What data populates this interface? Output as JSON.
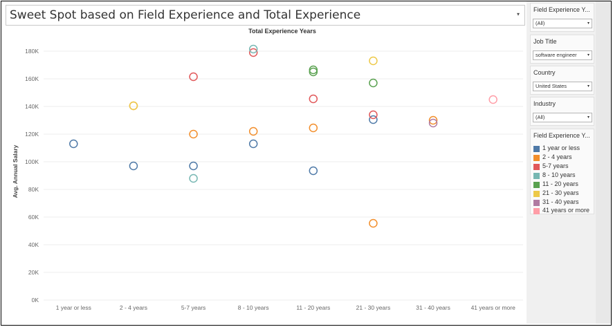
{
  "title": "Sweet Spot based on Field Experience and Total Experience",
  "title_caret": "▾",
  "filters": [
    {
      "title": "Field Experience Y...",
      "value": "(All)"
    },
    {
      "title": "Job Title",
      "value": "software engineer"
    },
    {
      "title": "Country",
      "value": "United States"
    },
    {
      "title": "Industry",
      "value": "(All)"
    }
  ],
  "select_caret": "▾",
  "legend": {
    "title": "Field Experience Y...",
    "items": [
      {
        "label": "1 year or less",
        "color": "#4e79a7"
      },
      {
        "label": "2 - 4 years",
        "color": "#f28e2b"
      },
      {
        "label": "5-7 years",
        "color": "#e15759"
      },
      {
        "label": "8 - 10 years",
        "color": "#76b7b2"
      },
      {
        "label": "11 - 20 years",
        "color": "#59a14f"
      },
      {
        "label": "21 - 30 years",
        "color": "#edc948"
      },
      {
        "label": "31 - 40 years",
        "color": "#b07aa1"
      },
      {
        "label": "41 years or more",
        "color": "#ff9da7"
      }
    ]
  },
  "chart_data": {
    "type": "scatter",
    "title": "Total Experience Years",
    "xlabel": "",
    "ylabel": "Avg. Annual Salary",
    "categories": [
      "1 year or less",
      "2 - 4 years",
      "5-7 years",
      "8 - 10 years",
      "11 - 20 years",
      "21 - 30 years",
      "31 - 40 years",
      "41 years or more"
    ],
    "ylim": [
      0,
      190000
    ],
    "yticks": [
      0,
      20000,
      40000,
      60000,
      80000,
      100000,
      120000,
      140000,
      160000,
      180000
    ],
    "ytick_labels": [
      "0K",
      "20K",
      "40K",
      "60K",
      "80K",
      "100K",
      "120K",
      "140K",
      "160K",
      "180K"
    ],
    "grid": true,
    "marker": "hollow-circle",
    "series": [
      {
        "name": "1 year or less",
        "color": "#4e79a7",
        "points": [
          [
            0,
            113000
          ],
          [
            1,
            97000
          ],
          [
            2,
            97000
          ],
          [
            3,
            113000
          ],
          [
            4,
            93500
          ],
          [
            5,
            130500
          ]
        ]
      },
      {
        "name": "2 - 4 years",
        "color": "#f28e2b",
        "points": [
          [
            1,
            140500
          ],
          [
            2,
            120000
          ],
          [
            3,
            122000
          ],
          [
            4,
            124500
          ],
          [
            5,
            55500
          ],
          [
            6,
            130000
          ]
        ]
      },
      {
        "name": "5-7 years",
        "color": "#e15759",
        "points": [
          [
            2,
            161500
          ],
          [
            3,
            179000
          ],
          [
            4,
            145500
          ],
          [
            5,
            134000
          ]
        ]
      },
      {
        "name": "8 - 10 years",
        "color": "#76b7b2",
        "points": [
          [
            2,
            88000
          ],
          [
            3,
            181500
          ]
        ]
      },
      {
        "name": "11 - 20 years",
        "color": "#59a14f",
        "points": [
          [
            4,
            166500
          ],
          [
            4,
            165000
          ],
          [
            5,
            157000
          ]
        ]
      },
      {
        "name": "21 - 30 years",
        "color": "#edc948",
        "points": [
          [
            1,
            140500
          ],
          [
            5,
            173000
          ]
        ]
      },
      {
        "name": "31 - 40 years",
        "color": "#b07aa1",
        "points": [
          [
            6,
            128000
          ]
        ]
      },
      {
        "name": "41 years or more",
        "color": "#ff9da7",
        "points": [
          [
            7,
            145000
          ]
        ]
      }
    ]
  }
}
